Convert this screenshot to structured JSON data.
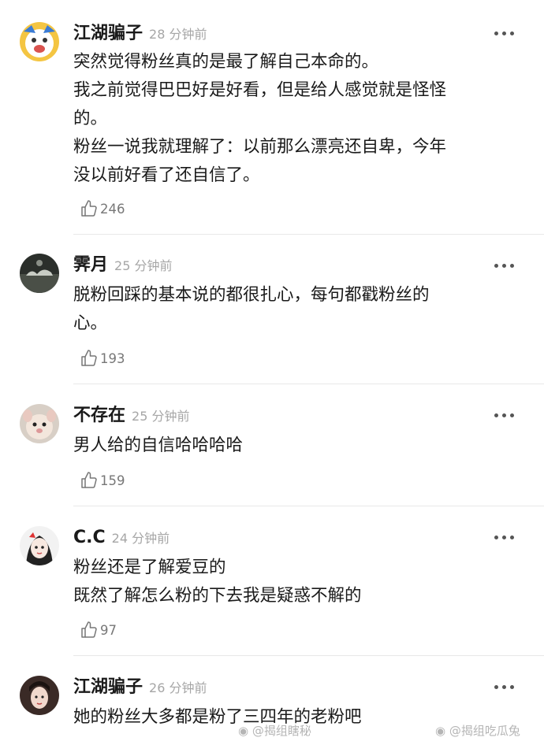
{
  "comments": [
    {
      "username": "江湖骗子",
      "time": "28 分钟前",
      "lines": [
        "突然觉得粉丝真的是最了解自己本命的。",
        "我之前觉得巴巴好是好看，但是给人感觉就是怪怪",
        "的。",
        "粉丝一说我就理解了：以前那么漂亮还自卑，今年",
        "没以前好看了还自信了。"
      ],
      "likes": "246"
    },
    {
      "username": "霁月",
      "time": "25 分钟前",
      "lines": [
        "脱粉回踩的基本说的都很扎心，每句都戳粉丝的",
        "心。"
      ],
      "likes": "193"
    },
    {
      "username": "不存在",
      "time": "25 分钟前",
      "lines": [
        "男人给的自信哈哈哈哈"
      ],
      "likes": "159"
    },
    {
      "username": "C.C",
      "time": "24 分钟前",
      "lines": [
        "粉丝还是了解爱豆的",
        "既然了解怎么粉的下去我是疑惑不解的"
      ],
      "likes": "97"
    },
    {
      "username": "江湖骗子",
      "time": "26 分钟前",
      "lines": [
        "她的粉丝大多都是粉了三四年的老粉吧"
      ]
    }
  ],
  "watermarks": [
    "@揭组瞎秘",
    "@揭组吃瓜兔"
  ],
  "icons": {
    "like": "thumbs-up-icon",
    "more": "more-dots-icon"
  }
}
